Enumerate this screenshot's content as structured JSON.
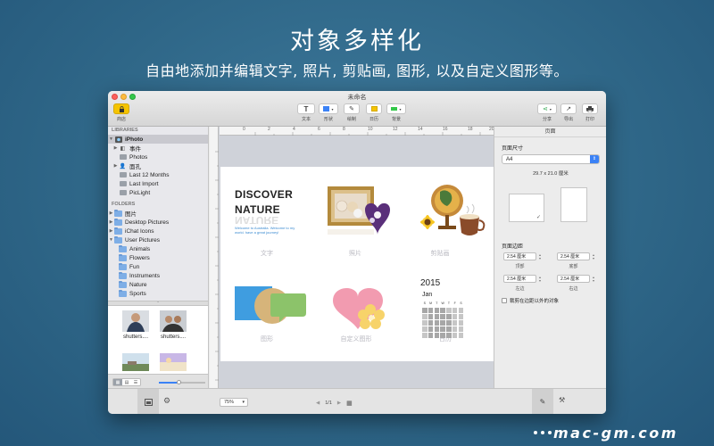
{
  "hero": {
    "title": "对象多样化",
    "subtitle": "自由地添加并编辑文字, 照片, 剪贴画, 图形, 以及自定义图形等。"
  },
  "window": {
    "title": "未命名",
    "toolbar": {
      "store_label": "商店",
      "text_label": "文本",
      "shape_label": "形状",
      "draw_label": "绘制",
      "calendar_label": "日历",
      "background_label": "背景",
      "share_label": "分享",
      "export_label": "导出",
      "print_label": "打印"
    }
  },
  "sidebar": {
    "libraries_header": "LIBRARIES",
    "library_items": [
      {
        "label": "iPhoto",
        "icon": "iphoto-icon"
      },
      {
        "label": "事件",
        "icon": "events-icon"
      },
      {
        "label": "Photos",
        "icon": "photos-icon"
      },
      {
        "label": "面孔",
        "icon": "faces-icon"
      },
      {
        "label": "Last 12 Months",
        "icon": "album-icon"
      },
      {
        "label": "Last Import",
        "icon": "album-icon"
      },
      {
        "label": "PicLight",
        "icon": "album-icon"
      }
    ],
    "folders_header": "FOLDERS",
    "folder_items": [
      {
        "label": "图片"
      },
      {
        "label": "Desktop Pictures"
      },
      {
        "label": "iChat Icons"
      },
      {
        "label": "User Pictures"
      },
      {
        "label": "Animals"
      },
      {
        "label": "Flowers"
      },
      {
        "label": "Fun"
      },
      {
        "label": "Instruments"
      },
      {
        "label": "Nature"
      },
      {
        "label": "Sports"
      }
    ],
    "thumbnails": [
      {
        "caption": "shutters...."
      },
      {
        "caption": "shutters...."
      }
    ]
  },
  "canvas": {
    "ruler_marks": [
      "0",
      "2",
      "4",
      "6",
      "8",
      "10",
      "12",
      "14",
      "16",
      "18",
      "20"
    ],
    "discover_line1": "DISCOVER",
    "discover_line2": "NATURE",
    "discover_reflection": "NATURE",
    "discover_sub": "Welcome to Australia. Welcome to my world. have a great journey!",
    "labels": {
      "text": "文字",
      "photo": "照片",
      "clipart": "剪贴画",
      "shape": "图形",
      "custom_shape": "自定义图形",
      "calendar": "日历"
    },
    "calendar": {
      "year": "2015",
      "month": "Jan",
      "weekdays": [
        "S",
        "M",
        "T",
        "W",
        "T",
        "F",
        "S"
      ]
    }
  },
  "inspector": {
    "tab": "页面",
    "page_size_label": "页面尺寸",
    "page_size_value": "A4",
    "dimensions": "29.7 x 21.0 厘米",
    "margins_label": "页面边距",
    "margins": {
      "top": {
        "value": "2.54 厘米",
        "label": "顶部"
      },
      "bottom": {
        "value": "2.54 厘米",
        "label": "底部"
      },
      "left": {
        "value": "2.54 厘米",
        "label": "左边"
      },
      "right": {
        "value": "2.54 厘米",
        "label": "右边"
      }
    },
    "crop_label": "裁剪在边距以外的对象"
  },
  "bottombar": {
    "zoom": "75%",
    "page_indicator": "1/1"
  },
  "watermark": "mac-gm.com",
  "colors": {
    "background": "#2f6788",
    "accent_blue": "#3b82f6",
    "heart_pink": "#f29bb0",
    "folder_blue": "#7eaee6"
  }
}
